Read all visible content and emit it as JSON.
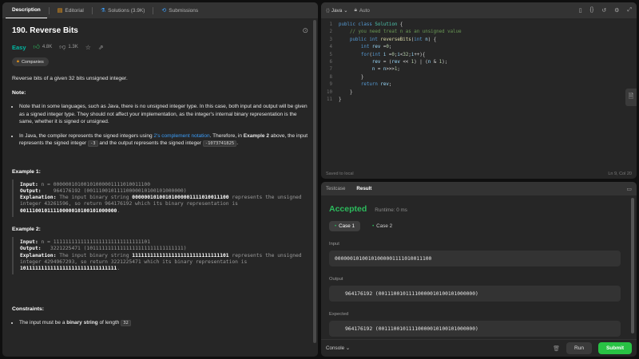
{
  "left_tabs": [
    {
      "label": "Description"
    },
    {
      "label": "Editorial"
    },
    {
      "label": "Solutions (3.9K)"
    },
    {
      "label": "Submissions"
    }
  ],
  "problem": {
    "title": "190. Reverse Bits",
    "difficulty": "Easy",
    "likes": "4.8K",
    "dislikes": "1.3K",
    "companies_label": "Companies",
    "statement": "Reverse bits of a given 32 bits unsigned integer.",
    "note_heading": "Note:",
    "note1": "Note that in some languages, such as Java, there is no unsigned integer type. In this case, both input and output will be given as a signed integer type. They should not affect your implementation, as the integer's internal binary representation is the same, whether it is signed or unsigned.",
    "note2_a": "In Java, the compiler represents the signed integers using ",
    "note2_link": "2's complement notation",
    "note2_b": ". Therefore, in ",
    "note2_bold": "Example 2",
    "note2_c": " above, the input represents the signed integer ",
    "note2_code1": "-3",
    "note2_d": " and the output represents the signed integer ",
    "note2_code2": "-1073741825",
    "note2_e": ".",
    "ex1_heading": "Example 1:",
    "ex1_input_lbl": "Input:",
    "ex1_input": " n = 00000010100101000001111010011100",
    "ex1_output_lbl": "Output:",
    "ex1_output": "    964176192 (00111001011110000010100101000000)",
    "ex1_expl_lbl": "Explanation:",
    "ex1_expl_a": " The input binary string ",
    "ex1_expl_b": "00000010100101000001111010011100",
    "ex1_expl_c": " represents the unsigned integer 43261596, so return 964176192 which its binary representation is ",
    "ex1_expl_d": "00111001011110000010100101000000",
    "ex1_expl_e": ".",
    "ex2_heading": "Example 2:",
    "ex2_input_lbl": "Input:",
    "ex2_input": " n = 11111111111111111111111111111101",
    "ex2_output_lbl": "Output:",
    "ex2_output": "   3221225471 (10111111111111111111111111111111)",
    "ex2_expl_lbl": "Explanation:",
    "ex2_expl_a": " The input binary string ",
    "ex2_expl_b": "11111111111111111111111111111101",
    "ex2_expl_c": " represents the unsigned integer 4294967293, so return 3221225471 which its binary representation is ",
    "ex2_expl_d": "10111111111111111111111111111111",
    "ex2_expl_e": ".",
    "constraints_heading": "Constraints:",
    "cons_a": "The input must be a ",
    "cons_bold": "binary string",
    "cons_b": " of length ",
    "cons_code": "32"
  },
  "editor": {
    "language": "Java",
    "mode": "Auto",
    "saved": "Saved to local",
    "position": "Ln 9, Col 20",
    "line_numbers": [
      "1",
      "2",
      "3",
      "4",
      "5",
      "6",
      "7",
      "8",
      "9",
      "10",
      "11"
    ]
  },
  "result": {
    "tabs": [
      "Testcase",
      "Result"
    ],
    "status": "Accepted",
    "runtime": "Runtime: 0 ms",
    "case1": "Case 1",
    "case2": "Case 2",
    "input_label": "Input",
    "input_value": "00000010100101000001111010011100",
    "output_label": "Output",
    "output_value": "964176192 (00111001011110000010100101000000)",
    "expected_label": "Expected",
    "expected_value": "964176192 (00111001011110000010100101000000)",
    "console": "Console",
    "run": "Run",
    "submit": "Submit"
  },
  "colors": {
    "accepted": "#2cbb5d",
    "easy": "#00b8a3",
    "submit": "#28c244",
    "link": "#3b9cf7"
  }
}
